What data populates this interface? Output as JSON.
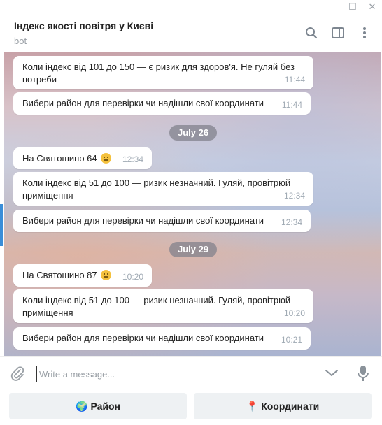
{
  "window": {
    "controls": {
      "minimize": "—",
      "maximize": "☐",
      "close": "✕"
    }
  },
  "header": {
    "title": "Індекс якості повітря у Києві",
    "subtitle": "bot",
    "icons": [
      "search-icon",
      "sidebar-toggle-icon",
      "more-vertical-icon"
    ]
  },
  "messages": [
    {
      "text_line1": "Коли індекс від 101 до 150 — є ризик для здоров'я. Не гуляй без",
      "text_line2": "потреби",
      "time": "11:44"
    },
    {
      "text_line1": "Вибери район для перевірки чи надішли свої координати",
      "time": "11:44"
    },
    {
      "date": "July 26"
    },
    {
      "text_line1": "На Святошино 64",
      "emoji": "neutral-face",
      "time": "12:34"
    },
    {
      "text_line1": "Коли індекс від 51 до 100 — ризик незначний. Гуляй, провітрюй",
      "text_line2": "приміщення",
      "time": "12:34"
    },
    {
      "text_line1": "Вибери район для перевірки чи надішли свої координати",
      "time": "12:34"
    },
    {
      "date": "July 29"
    },
    {
      "text_line1": "На Святошино 87",
      "emoji": "neutral-face",
      "time": "10:20"
    },
    {
      "text_line1": "Коли індекс від 51 до 100 — ризик незначний. Гуляй, провітрюй",
      "text_line2": "приміщення",
      "time": "10:20"
    },
    {
      "text_line1": "Вибери район для перевірки чи надішли свої координати",
      "time": "10:21"
    }
  ],
  "composer": {
    "placeholder": "Write a message...",
    "value": "",
    "icons": [
      "paperclip-icon",
      "chevron-down-icon",
      "microphone-icon"
    ]
  },
  "keyboard": {
    "buttons": [
      {
        "icon": "🌍",
        "label": "Район"
      },
      {
        "icon": "📍",
        "label": "Координати"
      }
    ]
  },
  "colors": {
    "accent": "#3a8ed8",
    "time_text": "#a0aab4",
    "date_pill": "#82828c"
  }
}
